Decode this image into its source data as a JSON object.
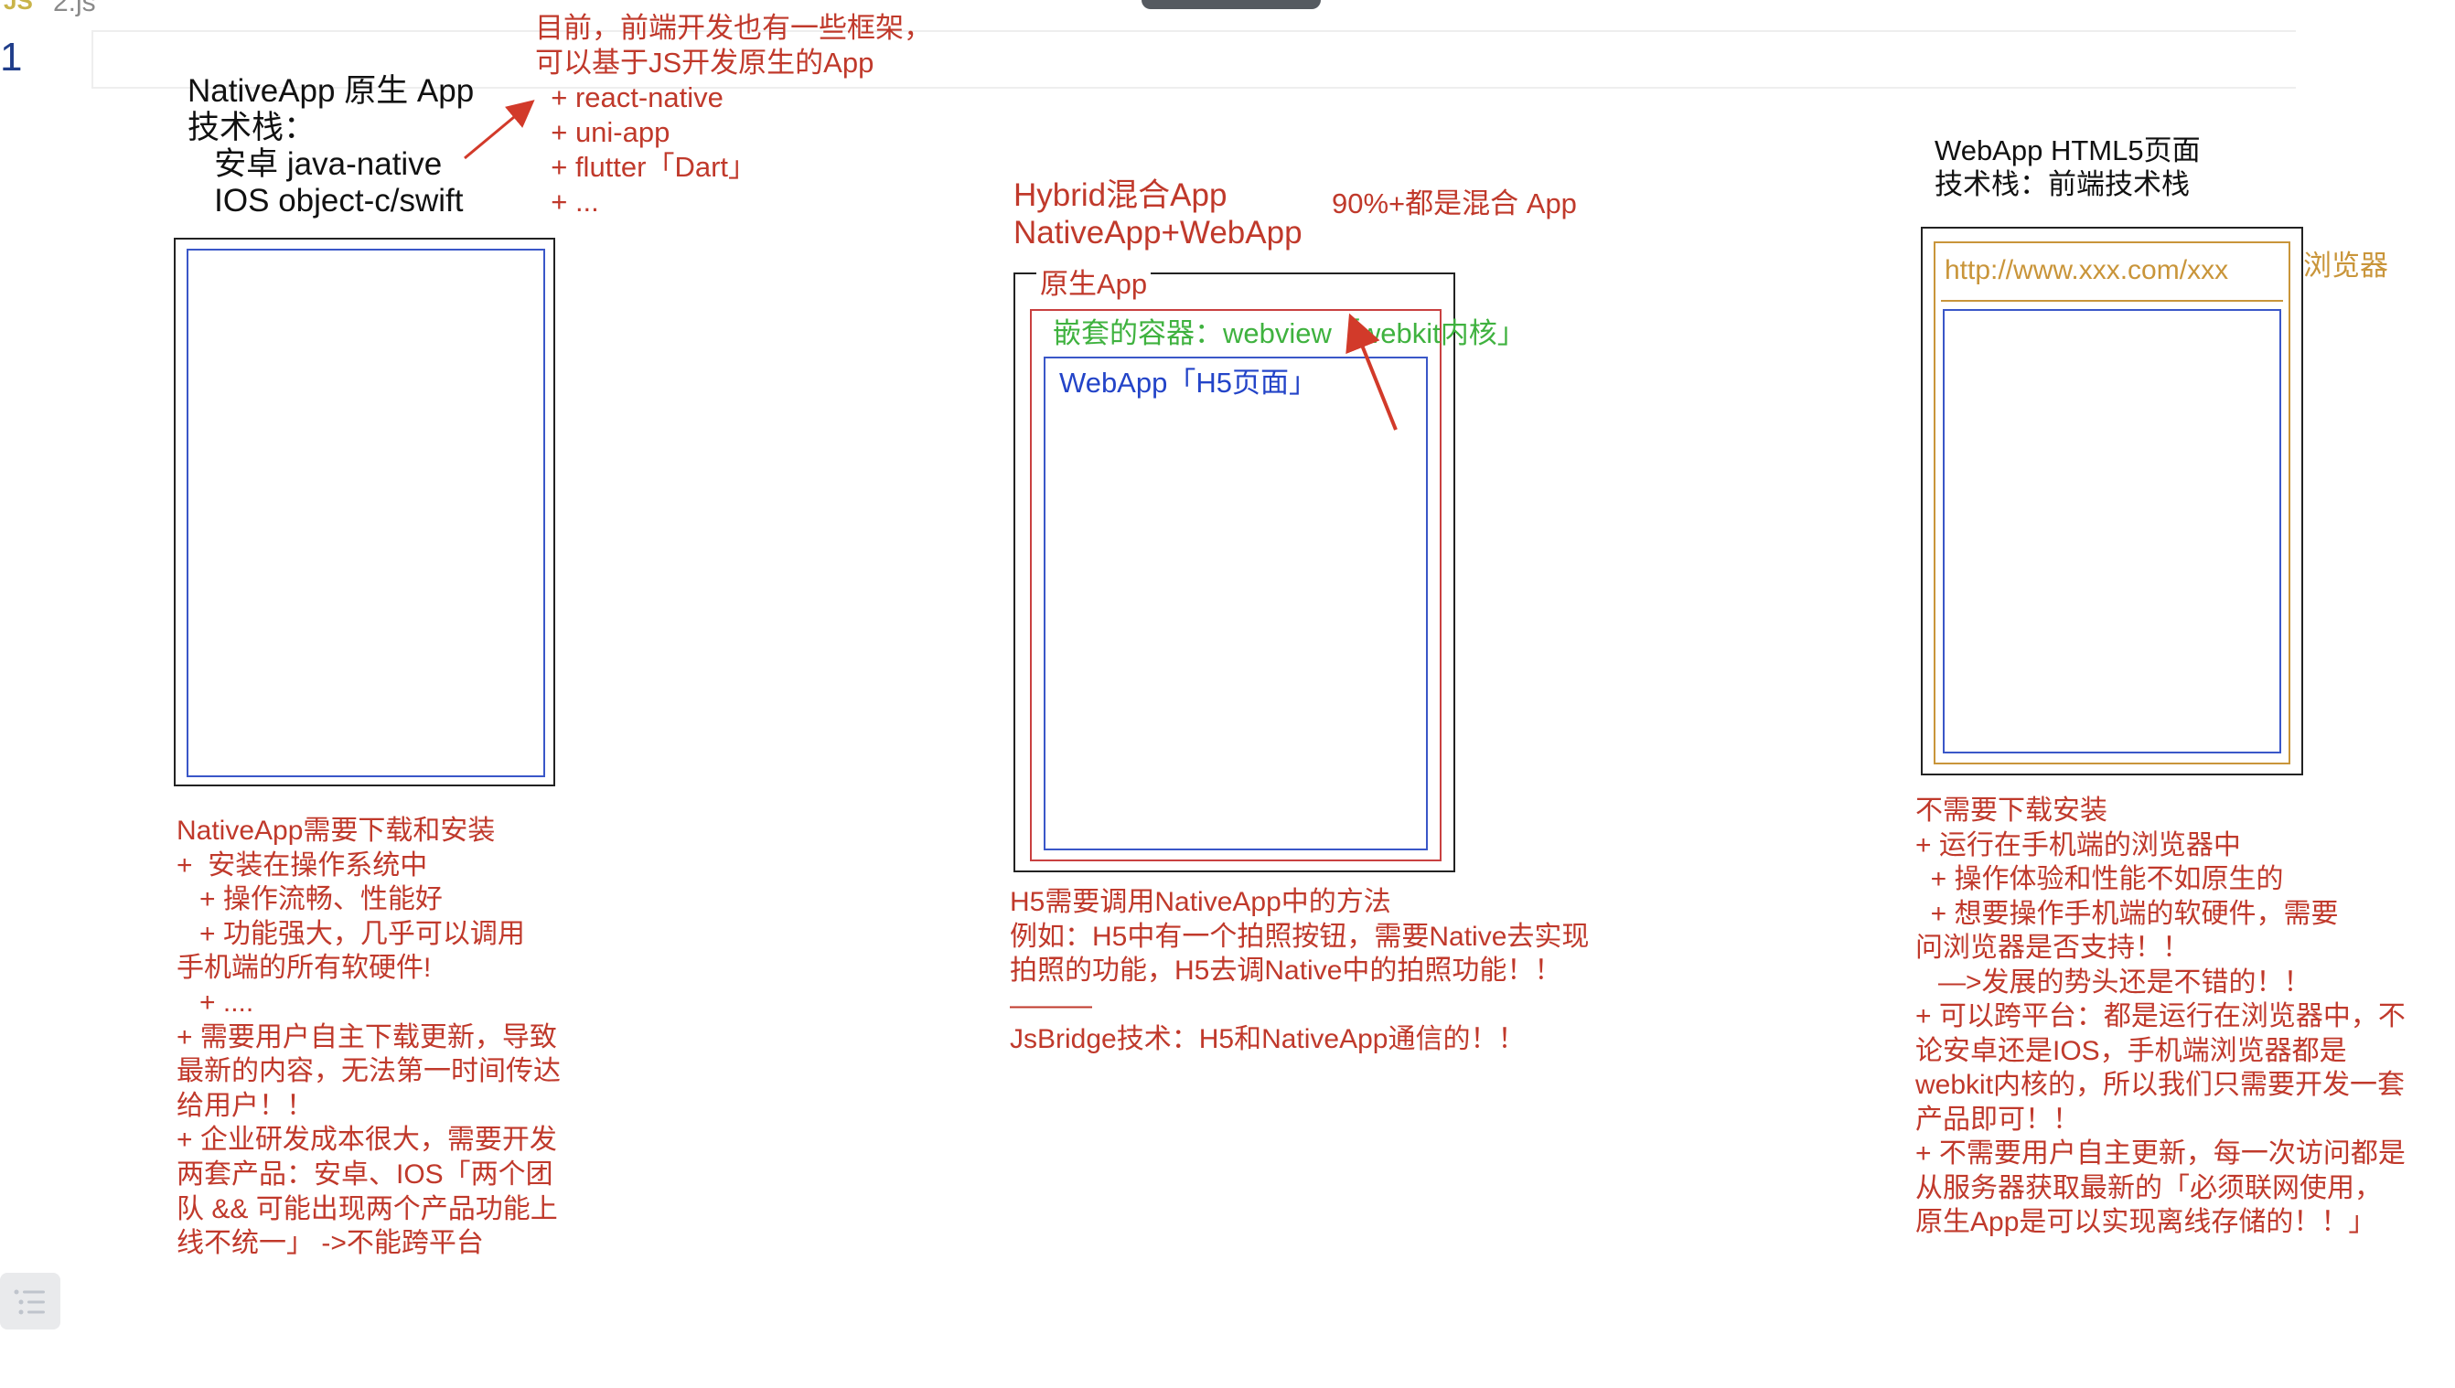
{
  "editor": {
    "file_icon_label": "JS",
    "file_name": "2.js",
    "line_number": "1"
  },
  "native": {
    "title": "NativeApp 原生 App\n技术栈：\n   安卓 java-native\n   IOS object-c/swift",
    "frameworks_note": "目前，前端开发也有一些框架，\n可以基于JS开发原生的App\n  + react-native\n  + uni-app\n  + flutter「Dart」\n  + ...",
    "description": "NativeApp需要下载和安装\n+  安装在操作系统中\n   + 操作流畅、性能好\n   + 功能强大，几乎可以调用\n手机端的所有软硬件!\n   + ....\n+ 需要用户自主下载更新，导致\n最新的内容，无法第一时间传达\n给用户！！\n+ 企业研发成本很大，需要开发\n两套产品：安卓、IOS「两个团\n队 && 可能出现两个产品功能上\n线不统一」 ->不能跨平台"
  },
  "hybrid": {
    "title": "Hybrid混合App\nNativeApp+WebApp",
    "share_note": "90%+都是混合 App",
    "native_label": "原生App",
    "container_label": "嵌套的容器：webview「webkit内核」",
    "webapp_label": "WebApp「H5页面」",
    "description": "H5需要调用NativeApp中的方法\n例如：H5中有一个拍照按钮，需要Native去实现\n拍照的功能，H5去调Native中的拍照功能！！\n———\nJsBridge技术：H5和NativeApp通信的！！"
  },
  "webapp": {
    "title": "WebApp HTML5页面\n技术栈：前端技术栈",
    "url": "http://www.xxx.com/xxx",
    "browser_label": "浏览器",
    "description": "不需要下载安装\n+ 运行在手机端的浏览器中\n  + 操作体验和性能不如原生的\n  + 想要操作手机端的软硬件，需要\n问浏览器是否支持！！\n   —>发展的势头还是不错的！！\n+ 可以跨平台：都是运行在浏览器中，不\n论安卓还是IOS，手机端浏览器都是\nwebkit内核的，所以我们只需要开发一套\n产品即可！！\n+ 不需要用户自主更新，每一次访问都是\n从服务器获取最新的「必须联网使用，\n原生App是可以实现离线存储的！！」"
  },
  "colors": {
    "annotation_red": "#c0392b",
    "container_green": "#3fb23f",
    "webapp_blue": "#2344c8",
    "browser_gold": "#c9953a"
  }
}
